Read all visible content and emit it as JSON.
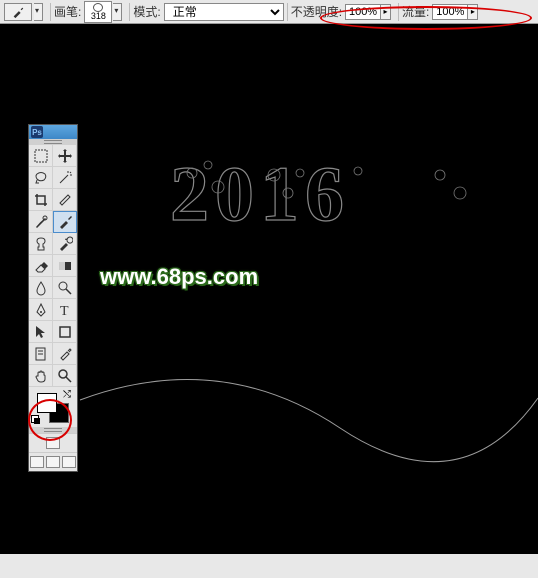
{
  "options": {
    "brush_label": "画笔:",
    "brush_size": "318",
    "mode_label": "模式:",
    "mode_value": "正常",
    "opacity_label": "不透明度:",
    "opacity_value": "100%",
    "flow_label": "流量:",
    "flow_value": "100%"
  },
  "toolbox": {
    "logo": "Ps",
    "tools": [
      {
        "name": "rect-marquee-tool",
        "glyph": "selection"
      },
      {
        "name": "move-tool",
        "glyph": "move"
      },
      {
        "name": "lasso-tool",
        "glyph": "lasso"
      },
      {
        "name": "magic-wand-tool",
        "glyph": "wand"
      },
      {
        "name": "crop-tool",
        "glyph": "crop"
      },
      {
        "name": "slice-tool",
        "glyph": "slice"
      },
      {
        "name": "healing-brush-tool",
        "glyph": "heal"
      },
      {
        "name": "brush-tool",
        "glyph": "brush",
        "selected": true
      },
      {
        "name": "clone-stamp-tool",
        "glyph": "stamp"
      },
      {
        "name": "history-brush-tool",
        "glyph": "history"
      },
      {
        "name": "eraser-tool",
        "glyph": "eraser"
      },
      {
        "name": "gradient-tool",
        "glyph": "gradient"
      },
      {
        "name": "blur-tool",
        "glyph": "blur"
      },
      {
        "name": "dodge-tool",
        "glyph": "dodge"
      },
      {
        "name": "pen-tool",
        "glyph": "pen"
      },
      {
        "name": "type-tool",
        "glyph": "type"
      },
      {
        "name": "path-selection-tool",
        "glyph": "pathsel"
      },
      {
        "name": "shape-tool",
        "glyph": "shape"
      },
      {
        "name": "notes-tool",
        "glyph": "notes"
      },
      {
        "name": "eyedropper-tool",
        "glyph": "eyedrop"
      },
      {
        "name": "hand-tool",
        "glyph": "hand"
      },
      {
        "name": "zoom-tool",
        "glyph": "zoom"
      }
    ],
    "fg_color": "#ffffff",
    "bg_color": "#000000"
  },
  "canvas": {
    "text": "2016",
    "watermark": "www.68ps.com"
  }
}
